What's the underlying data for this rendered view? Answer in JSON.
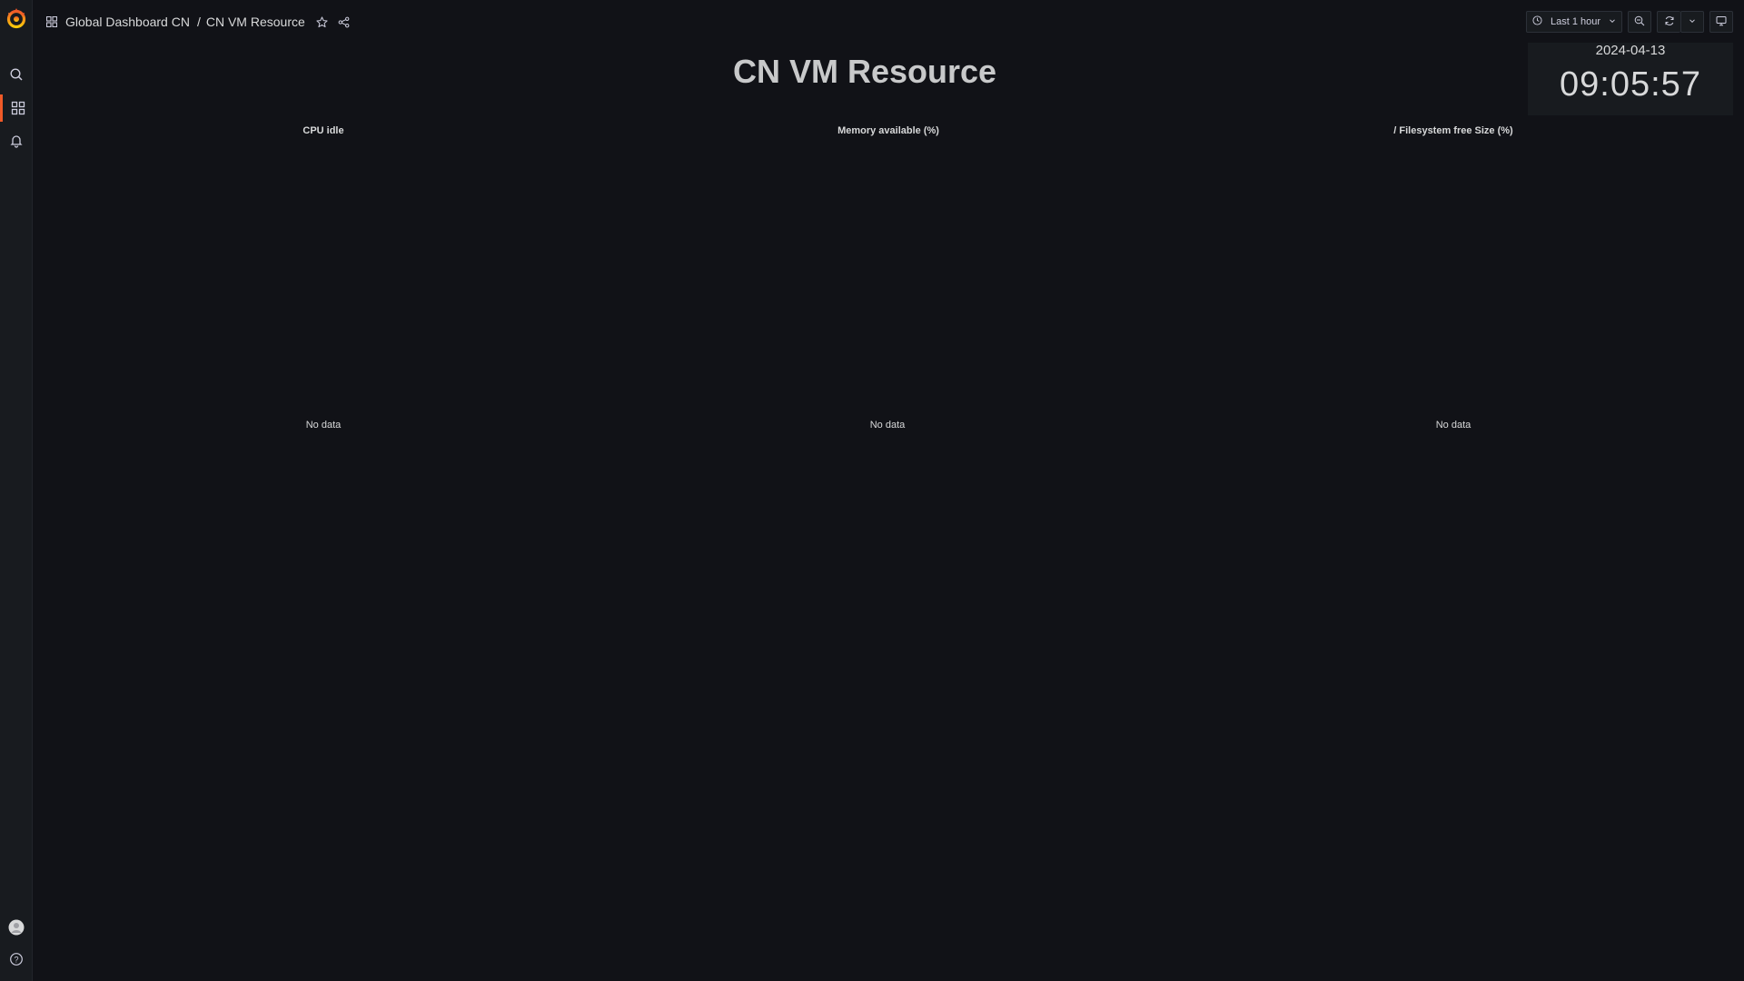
{
  "breadcrumb": {
    "folder": "Global Dashboard CN",
    "separator": "/",
    "dashboard": "CN VM Resource"
  },
  "toolbar": {
    "time_range": "Last 1 hour"
  },
  "dashboard_title": "CN VM Resource",
  "clock": {
    "date": "2024-04-13",
    "time": "09:05:57"
  },
  "panels": [
    {
      "title": "CPU idle",
      "status": "No data"
    },
    {
      "title": "Memory available (%)",
      "status": "No data"
    },
    {
      "title": "/ Filesystem free Size (%)",
      "status": "No data"
    }
  ],
  "icons": {
    "logo": "grafana-logo",
    "search": "search-icon",
    "dashboards": "dashboards-icon",
    "alerting": "bell-icon",
    "profile": "avatar",
    "help": "help-icon"
  },
  "colors": {
    "background": "#111217",
    "sidebar": "#181b1f",
    "accent": "#f05a28"
  }
}
